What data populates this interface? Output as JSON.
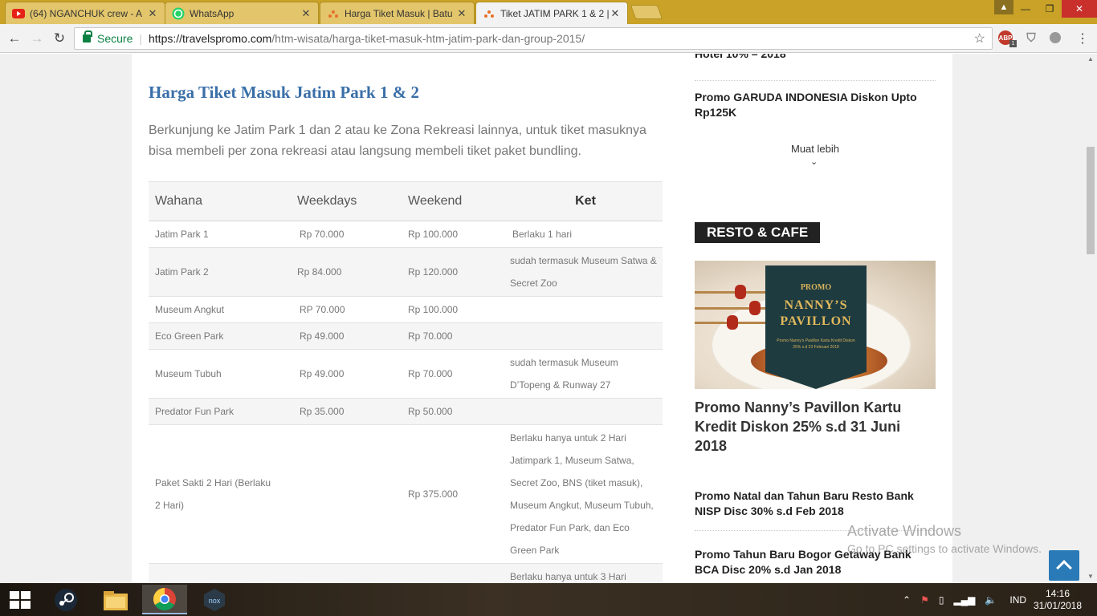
{
  "browser": {
    "tabs": [
      {
        "title": "(64) NGANCHUK crew - A",
        "icon": "youtube-icon"
      },
      {
        "title": "WhatsApp",
        "icon": "whatsapp-icon"
      },
      {
        "title": "Harga Tiket Masuk | Batu",
        "icon": "site-icon"
      },
      {
        "title": "Tiket JATIM PARK 1 & 2 |",
        "icon": "site-icon"
      }
    ],
    "secure_label": "Secure",
    "url_host": "https://travelspromo.com",
    "url_path": "/htm-wisata/harga-tiket-masuk-htm-jatim-park-dan-group-2015/",
    "extensions": [
      {
        "name": "adblock",
        "label": "ABP",
        "badge": "1",
        "color": "#c0392b"
      }
    ]
  },
  "article": {
    "title": "Harga Tiket Masuk Jatim Park 1 & 2",
    "intro": "Berkunjung ke Jatim Park 1 dan 2 atau ke Zona Rekreasi lainnya, untuk tiket masuknya bisa membeli per zona rekreasi atau langsung membeli tiket paket bundling.",
    "table": {
      "headers": [
        "Wahana",
        "Weekdays",
        "Weekend",
        "Ket"
      ],
      "rows": [
        {
          "wahana": "Jatim Park 1",
          "weekdays": "Rp 70.000",
          "weekend": "Rp 100.000",
          "ket": "Berlaku 1 hari"
        },
        {
          "wahana": "Jatim Park 2",
          "weekdays": "Rp 84.000",
          "weekend": "Rp 120.000",
          "ket": "sudah termasuk Museum Satwa & Secret Zoo"
        },
        {
          "wahana": "Museum Angkut",
          "weekdays": "RP 70.000",
          "weekend": "Rp 100.000",
          "ket": ""
        },
        {
          "wahana": "Eco Green Park",
          "weekdays": "Rp 49.000",
          "weekend": "Rp 70.000",
          "ket": ""
        },
        {
          "wahana": "Museum Tubuh",
          "weekdays": "Rp 49.000",
          "weekend": "Rp 70.000",
          "ket": "sudah termasuk Museum D’Topeng & Runway 27"
        },
        {
          "wahana": "Predator Fun Park",
          "weekdays": "Rp 35.000",
          "weekend": "Rp 50.000",
          "ket": ""
        },
        {
          "wahana": "Paket Sakti 2 Hari (Berlaku 2 Hari)",
          "weekdays": "",
          "weekend": "Rp 375.000",
          "ket": "Berlaku hanya untuk 2 Hari Jatimpark 1, Museum Satwa, Secret Zoo, BNS (tiket masuk), Museum Angkut, Museum Tubuh, Predator Fun Park, dan Eco Green Park"
        },
        {
          "wahana": "",
          "weekdays": "",
          "weekend": "",
          "ket": "Berlaku hanya untuk 3 Hari"
        }
      ]
    }
  },
  "sidebar": {
    "top_link_partial": "Hotel 10% – 2018",
    "links_top": [
      "Promo GARUDA INDONESIA Diskon Upto Rp125K"
    ],
    "more_label": "Muat lebih",
    "section_title": "RESTO & CAFE",
    "promo_image": {
      "promo_word": "PROMO",
      "name": "NANNY’S PAVILLON",
      "sub": "Promo Nanny's Pavillon Kartu Kredit Diskon 25% s.d 23 Februari 2018"
    },
    "featured_title": "Promo Nanny’s Pavillon Kartu Kredit Diskon 25% s.d 31 Juni 2018",
    "links_bottom": [
      "Promo Natal dan Tahun Baru Resto Bank NISP Disc 30% s.d Feb 2018",
      "Promo Tahun Baru Bogor Getaway Bank BCA Disc 20% s.d Jan 2018"
    ]
  },
  "watermark": {
    "line1": "Activate Windows",
    "line2": "Go to PC settings to activate Windows."
  },
  "taskbar": {
    "apps": [
      "steam",
      "file-explorer",
      "chrome",
      "nox"
    ],
    "language": "IND",
    "time": "14:16",
    "date": "31/01/2018"
  }
}
